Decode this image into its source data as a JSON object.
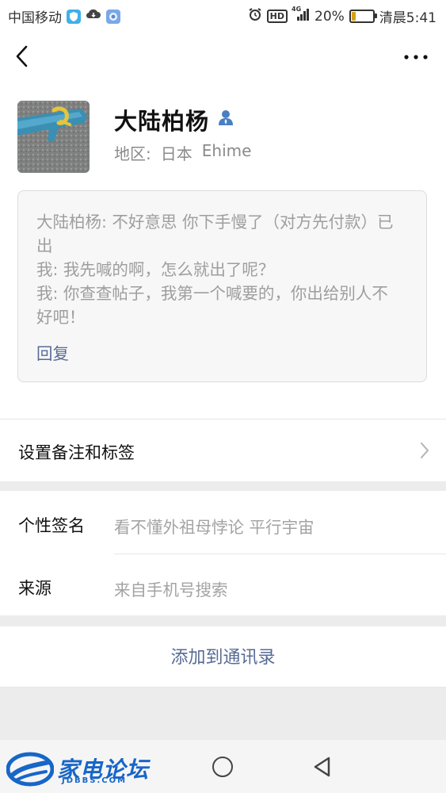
{
  "status_bar": {
    "carrier": "中国移动",
    "network": "4G",
    "battery": "20%",
    "time": "清晨5:41",
    "icons": [
      "shield-app-icon",
      "cloud-icon",
      "gallery-app-icon",
      "alarm-icon",
      "hd-icon",
      "signal-icon",
      "battery-icon"
    ],
    "hd_label": "HD",
    "battery_level": 0.2
  },
  "nav": {
    "back_icon": "chevron-left-icon",
    "more_icon": "more-dots-icon"
  },
  "profile": {
    "name": "大陆柏杨",
    "region_label": "地区:",
    "region_country": "日本",
    "region_city": "Ehime",
    "gender_icon": "person-icon"
  },
  "message_card": {
    "line1": "大陆柏杨: 不好意思 你下手慢了（对方先付款）已出",
    "line2": "我: 我先喊的啊，怎么就出了呢？",
    "line3": "我: 你查查帖子，我第一个喊要的，你出给别人不好吧！",
    "reply": "回复"
  },
  "settings": {
    "remark_label": "设置备注和标签"
  },
  "info": {
    "signature_label": "个性签名",
    "signature_value": "看不懂外祖母悖论 平行宇宙",
    "source_label": "来源",
    "source_value": "来自手机号搜索"
  },
  "actions": {
    "add_contact": "添加到通讯录"
  },
  "watermark": {
    "logo_text": "家电论坛",
    "logo_sub": "JDBBS.COM"
  },
  "colors": {
    "link": "#576b95",
    "bg_gap": "#ececec",
    "card_bg": "#f7f7f7"
  }
}
